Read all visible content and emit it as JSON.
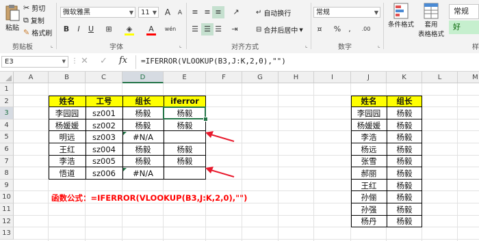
{
  "ribbon": {
    "clipboard": {
      "paste": "粘贴",
      "cut": "剪切",
      "copy": "复制",
      "format_painter": "格式刷",
      "group_label": "剪贴板"
    },
    "font": {
      "name": "微软雅黑",
      "size": "11",
      "bold": "B",
      "italic": "I",
      "underline": "U",
      "grow": "A",
      "shrink": "A",
      "fill_label": "A",
      "wen": "wén",
      "group_label": "字体"
    },
    "alignment": {
      "wrap_text": "自动换行",
      "merge_center": "合并后居中",
      "group_label": "对齐方式"
    },
    "number": {
      "format": "常规",
      "percent": "%",
      "comma": ",",
      "inc_dec": ".00",
      "group_label": "数字"
    },
    "styles": {
      "conditional": "条件格式",
      "table_style": "套用",
      "table_style2": "表格格式",
      "normal": "常规",
      "good": "好",
      "group_label": "样"
    }
  },
  "formula_bar": {
    "name_box": "E3",
    "cancel": "✕",
    "enter": "✓",
    "fx": "fx",
    "formula": "=IFERROR(VLOOKUP(B3,J:K,2,0),\"\")"
  },
  "columns": [
    "A",
    "B",
    "C",
    "D",
    "E",
    "F",
    "G",
    "H",
    "I",
    "J",
    "K",
    "L",
    "M"
  ],
  "rows": [
    "1",
    "2",
    "3",
    "4",
    "5",
    "6",
    "7",
    "8",
    "9",
    "10",
    "11",
    "12",
    "13"
  ],
  "main_table": {
    "headers": [
      "姓名",
      "工号",
      "组长",
      "iferror"
    ],
    "rows": [
      [
        "李园园",
        "sz001",
        "杨毅",
        "杨毅"
      ],
      [
        "杨媛媛",
        "sz002",
        "杨毅",
        "杨毅"
      ],
      [
        "明远",
        "sz003",
        "#N/A",
        ""
      ],
      [
        "王红",
        "sz004",
        "杨毅",
        "杨毅"
      ],
      [
        "李浩",
        "sz005",
        "杨毅",
        "杨毅"
      ],
      [
        "悟道",
        "sz006",
        "#N/A",
        ""
      ]
    ]
  },
  "lookup_table": {
    "headers": [
      "姓名",
      "组长"
    ],
    "rows": [
      [
        "李园园",
        "杨毅"
      ],
      [
        "杨媛媛",
        "杨毅"
      ],
      [
        "李浩",
        "杨毅"
      ],
      [
        "杨远",
        "杨毅"
      ],
      [
        "张雪",
        "杨毅"
      ],
      [
        "郝丽",
        "杨毅"
      ],
      [
        "王红",
        "杨毅"
      ],
      [
        "孙俪",
        "杨毅"
      ],
      [
        "孙强",
        "杨毅"
      ],
      [
        "杨丹",
        "杨毅"
      ]
    ]
  },
  "note": "函数公式：=IFERROR(VLOOKUP(B3,J:K,2,0),\"\")",
  "colors": {
    "header_fill": "#ffff00",
    "note": "#ff0000",
    "arrow": "#e8192c",
    "accent": "#217346"
  }
}
